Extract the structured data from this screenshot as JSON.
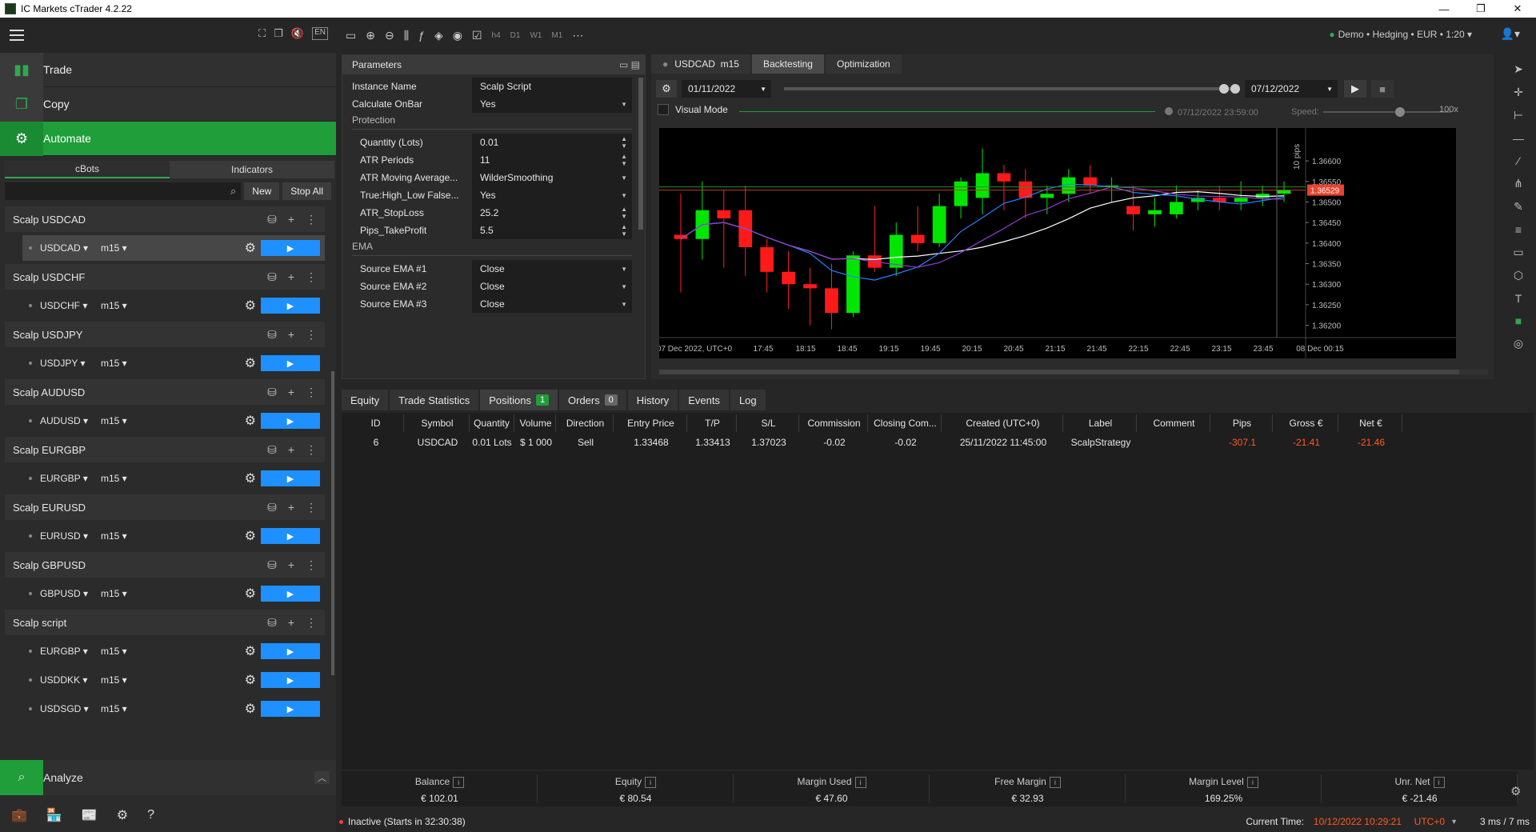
{
  "window": {
    "title": "IC Markets cTrader 4.2.22"
  },
  "left_tools": {
    "lang": "EN"
  },
  "nav": {
    "trade": "Trade",
    "copy": "Copy",
    "automate": "Automate",
    "analyze": "Analyze"
  },
  "automate_tabs": [
    "cBots",
    "Indicators"
  ],
  "automate_buttons": {
    "new": "New",
    "stop_all": "Stop All"
  },
  "bots": [
    {
      "name": "Scalp  USDCAD",
      "instances": [
        {
          "symbol": "USDCAD",
          "tf": "m15",
          "selected": true
        }
      ]
    },
    {
      "name": "Scalp  USDCHF",
      "instances": [
        {
          "symbol": "USDCHF",
          "tf": "m15"
        }
      ]
    },
    {
      "name": "Scalp  USDJPY",
      "instances": [
        {
          "symbol": "USDJPY",
          "tf": "m15"
        }
      ]
    },
    {
      "name": "Scalp AUDUSD",
      "instances": [
        {
          "symbol": "AUDUSD",
          "tf": "m15"
        }
      ]
    },
    {
      "name": "Scalp EURGBP",
      "instances": [
        {
          "symbol": "EURGBP",
          "tf": "m15"
        }
      ]
    },
    {
      "name": "Scalp EURUSD",
      "instances": [
        {
          "symbol": "EURUSD",
          "tf": "m15"
        }
      ]
    },
    {
      "name": "Scalp GBPUSD",
      "instances": [
        {
          "symbol": "GBPUSD",
          "tf": "m15"
        }
      ]
    },
    {
      "name": "Scalp script",
      "instances": [
        {
          "symbol": "EURGBP",
          "tf": "m15"
        },
        {
          "symbol": "USDDKK",
          "tf": "m15"
        },
        {
          "symbol": "USDSGD",
          "tf": "m15"
        }
      ]
    }
  ],
  "toolbar": {
    "timeframes": [
      "h4",
      "D1",
      "W1",
      "M1"
    ]
  },
  "account": "Demo • Hedging • EUR • 1:20",
  "parameters": {
    "title": "Parameters",
    "rows": [
      {
        "label": "Instance Name",
        "value": "Scalp Script",
        "kind": "text"
      },
      {
        "label": "Calculate OnBar",
        "value": "Yes",
        "kind": "select"
      }
    ],
    "section_protection": "Protection",
    "protection_rows": [
      {
        "label": "Quantity (Lots)",
        "value": "0.01",
        "kind": "num"
      },
      {
        "label": "ATR Periods",
        "value": "11",
        "kind": "num"
      },
      {
        "label": "ATR Moving Average...",
        "value": "WilderSmoothing",
        "kind": "select"
      },
      {
        "label": "True:High_Low False...",
        "value": "Yes",
        "kind": "select"
      },
      {
        "label": "ATR_StopLoss",
        "value": "25.2",
        "kind": "num"
      },
      {
        "label": "Pips_TakeProfit",
        "value": "5.5",
        "kind": "num"
      }
    ],
    "section_ema": "EMA",
    "ema_rows": [
      {
        "label": "Source EMA #1",
        "value": "Close",
        "kind": "select"
      },
      {
        "label": "Source EMA #2",
        "value": "Close",
        "kind": "select"
      },
      {
        "label": "Source EMA #3",
        "value": "Close",
        "kind": "select"
      }
    ]
  },
  "chart_tabs": {
    "symbol": "USDCAD",
    "tf": "m15",
    "backtesting": "Backtesting",
    "optimization": "Optimization"
  },
  "backtest": {
    "start_date": "01/11/2022",
    "end_date": "07/12/2022",
    "visual_mode": "Visual Mode",
    "current_time": "07/12/2022 23:59:00",
    "speed_label": "Speed:",
    "speed_value": "100x"
  },
  "chart_data": {
    "type": "candlestick",
    "symbol": "USDCAD",
    "timeframe": "m15",
    "x_labels": [
      "07 Dec 2022, UTC+0",
      "17:45",
      "18:15",
      "18:45",
      "19:15",
      "19:45",
      "20:15",
      "20:45",
      "21:15",
      "21:45",
      "22:15",
      "22:45",
      "23:15",
      "23:45",
      "08 Dec 00:15"
    ],
    "y_ticks": [
      "1.36600",
      "1.36550",
      "1.36500",
      "1.36450",
      "1.36400",
      "1.36350",
      "1.36300",
      "1.36250",
      "1.36200"
    ],
    "ylim": [
      1.3617,
      1.3668
    ],
    "current_price": "1.36529",
    "scale_label": "10 pips",
    "candles": [
      {
        "o": 1.3642,
        "h": 1.3652,
        "l": 1.3628,
        "c": 1.3641
      },
      {
        "o": 1.3641,
        "h": 1.3655,
        "l": 1.3636,
        "c": 1.3648
      },
      {
        "o": 1.3648,
        "h": 1.3653,
        "l": 1.3634,
        "c": 1.3646
      },
      {
        "o": 1.3648,
        "h": 1.3654,
        "l": 1.3632,
        "c": 1.3639
      },
      {
        "o": 1.3639,
        "h": 1.3641,
        "l": 1.3628,
        "c": 1.3633
      },
      {
        "o": 1.3633,
        "h": 1.3638,
        "l": 1.3624,
        "c": 1.363
      },
      {
        "o": 1.363,
        "h": 1.3634,
        "l": 1.362,
        "c": 1.3629
      },
      {
        "o": 1.3629,
        "h": 1.3635,
        "l": 1.3619,
        "c": 1.3623
      },
      {
        "o": 1.3623,
        "h": 1.3638,
        "l": 1.3622,
        "c": 1.3637
      },
      {
        "o": 1.3637,
        "h": 1.3649,
        "l": 1.3633,
        "c": 1.3634
      },
      {
        "o": 1.3634,
        "h": 1.3645,
        "l": 1.3632,
        "c": 1.3642
      },
      {
        "o": 1.3642,
        "h": 1.3649,
        "l": 1.3638,
        "c": 1.364
      },
      {
        "o": 1.364,
        "h": 1.3652,
        "l": 1.3639,
        "c": 1.3649
      },
      {
        "o": 1.3649,
        "h": 1.3656,
        "l": 1.3646,
        "c": 1.3655
      },
      {
        "o": 1.3651,
        "h": 1.3663,
        "l": 1.3647,
        "c": 1.3657
      },
      {
        "o": 1.3657,
        "h": 1.3659,
        "l": 1.3648,
        "c": 1.3655
      },
      {
        "o": 1.3655,
        "h": 1.3658,
        "l": 1.3646,
        "c": 1.3651
      },
      {
        "o": 1.3651,
        "h": 1.3654,
        "l": 1.3647,
        "c": 1.3652
      },
      {
        "o": 1.3652,
        "h": 1.3658,
        "l": 1.365,
        "c": 1.3656
      },
      {
        "o": 1.3656,
        "h": 1.3659,
        "l": 1.3652,
        "c": 1.3654
      },
      {
        "o": 1.3654,
        "h": 1.3656,
        "l": 1.365,
        "c": 1.3654
      },
      {
        "o": 1.3649,
        "h": 1.3654,
        "l": 1.3643,
        "c": 1.3647
      },
      {
        "o": 1.3647,
        "h": 1.3651,
        "l": 1.3644,
        "c": 1.3648
      },
      {
        "o": 1.3647,
        "h": 1.3654,
        "l": 1.3646,
        "c": 1.365
      },
      {
        "o": 1.365,
        "h": 1.3653,
        "l": 1.3648,
        "c": 1.3651
      },
      {
        "o": 1.3651,
        "h": 1.3654,
        "l": 1.3648,
        "c": 1.365
      },
      {
        "o": 1.365,
        "h": 1.3655,
        "l": 1.3648,
        "c": 1.3651
      },
      {
        "o": 1.3651,
        "h": 1.3654,
        "l": 1.3649,
        "c": 1.3652
      },
      {
        "o": 1.3652,
        "h": 1.3655,
        "l": 1.365,
        "c": 1.3653
      }
    ]
  },
  "bottom_tabs": [
    {
      "label": "Equity"
    },
    {
      "label": "Trade Statistics"
    },
    {
      "label": "Positions",
      "badge": "1"
    },
    {
      "label": "Orders",
      "badge": "0"
    },
    {
      "label": "History"
    },
    {
      "label": "Events"
    },
    {
      "label": "Log"
    }
  ],
  "positions": {
    "columns": [
      "ID",
      "Symbol",
      "Quantity",
      "Volume",
      "Direction",
      "Entry Price",
      "T/P",
      "S/L",
      "Commission",
      "Closing Com...",
      "Created (UTC+0)",
      "Label",
      "Comment",
      "Pips",
      "Gross €",
      "Net €"
    ],
    "rows": [
      [
        "6",
        "USDCAD",
        "0.01 Lots",
        "$ 1 000",
        "Sell",
        "1.33468",
        "1.33413",
        "1.37023",
        "-0.02",
        "-0.02",
        "25/11/2022 11:45:00",
        "ScalpStrategy",
        "",
        "-307.1",
        "-21.41",
        "-21.46"
      ]
    ]
  },
  "summary": [
    {
      "label": "Balance",
      "value": "€ 102.01"
    },
    {
      "label": "Equity",
      "value": "€ 80.54"
    },
    {
      "label": "Margin Used",
      "value": "€ 47.60"
    },
    {
      "label": "Free Margin",
      "value": "€ 32.93"
    },
    {
      "label": "Margin Level",
      "value": "169.25%"
    },
    {
      "label": "Unr. Net",
      "value": "€ -21.46"
    }
  ],
  "status": {
    "state": "Inactive (Starts in 32:30:38)",
    "current_time_label": "Current Time:",
    "current_time": "10/12/2022 10:29:21",
    "tz": "UTC+0",
    "latency": "3 ms / 7 ms"
  },
  "colors": {
    "automate": "#1f9e3a",
    "play": "#1e90ff",
    "bull": "#00e600",
    "bear": "#ff1a1a",
    "negative": "#ff5a1f",
    "price_tag": "#e8442e"
  }
}
